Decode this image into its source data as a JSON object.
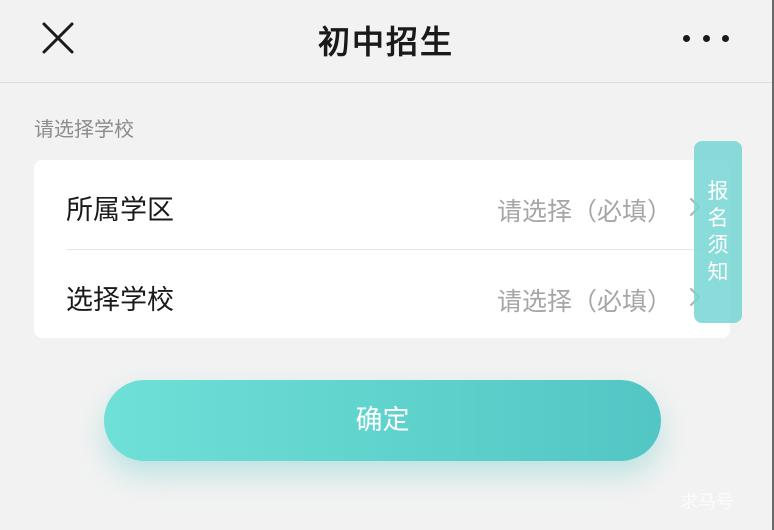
{
  "header": {
    "title": "初中招生",
    "close_icon": "close-icon",
    "more_icon": "more-dots-icon"
  },
  "section_label": "请选择学校",
  "form": {
    "rows": [
      {
        "label": "所属学区",
        "placeholder": "请选择（必填）"
      },
      {
        "label": "选择学校",
        "placeholder": "请选择（必填）"
      }
    ]
  },
  "side_tab": {
    "chars": [
      "报",
      "名",
      "须",
      "知"
    ]
  },
  "confirm_label": "确定",
  "watermark": "求马号",
  "colors": {
    "accent": "#5ccfcb",
    "background": "#f2f2f2",
    "card": "#ffffff"
  }
}
